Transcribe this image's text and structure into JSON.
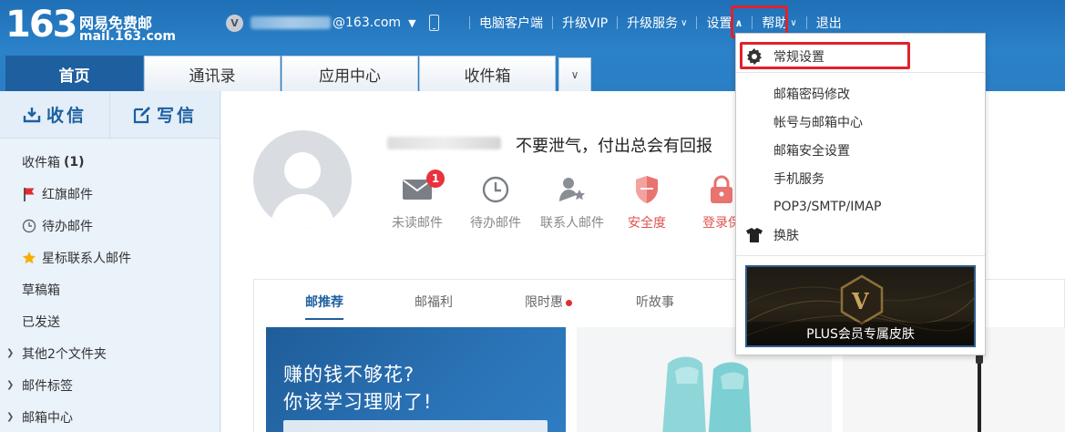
{
  "brand": {
    "logo_number": "163",
    "logo_cn": "网易免费邮",
    "logo_domain": "mail.163.com"
  },
  "account": {
    "badge_letter": "V",
    "email_suffix": "@163.com"
  },
  "topnav": {
    "desktop_client": "电脑客户端",
    "upgrade_vip": "升级VIP",
    "upgrade_service": "升级服务",
    "settings": "设置",
    "help": "帮助",
    "logout": "退出"
  },
  "tabs": [
    {
      "label": "首页"
    },
    {
      "label": "通讯录"
    },
    {
      "label": "应用中心"
    },
    {
      "label": "收件箱"
    }
  ],
  "sidebar": {
    "receive_label": "收信",
    "compose_label": "写信",
    "items": [
      {
        "label": "收件箱",
        "count": "(1)"
      },
      {
        "label": "红旗邮件"
      },
      {
        "label": "待办邮件"
      },
      {
        "label": "星标联系人邮件"
      },
      {
        "label": "草稿箱"
      },
      {
        "label": "已发送"
      },
      {
        "label": "其他2个文件夹"
      },
      {
        "label": "邮件标签"
      },
      {
        "label": "邮箱中心"
      }
    ]
  },
  "profile": {
    "motto": "不要泄气，付出总会有回报"
  },
  "quick_actions": [
    {
      "label": "未读邮件",
      "badge": "1"
    },
    {
      "label": "待办邮件"
    },
    {
      "label": "联系人邮件"
    },
    {
      "label": "安全度"
    },
    {
      "label": "登录保"
    }
  ],
  "recommend": {
    "tabs": [
      {
        "label": "邮推荐"
      },
      {
        "label": "邮福利"
      },
      {
        "label": "限时惠"
      },
      {
        "label": "听故事"
      }
    ],
    "banner_line1": "赚的钱不够花?",
    "banner_line2": "你该学习理财了!"
  },
  "settings_menu": {
    "items": [
      {
        "label": "常规设置"
      },
      {
        "label": "邮箱密码修改"
      },
      {
        "label": "帐号与邮箱中心"
      },
      {
        "label": "邮箱安全设置"
      },
      {
        "label": "手机服务"
      },
      {
        "label": "POP3/SMTP/IMAP"
      },
      {
        "label": "换肤"
      }
    ],
    "skin_badge": "V",
    "skin_caption": "PLUS会员专属皮肤"
  },
  "colors": {
    "header_blue": "#2a7ec4",
    "accent_blue": "#1d5f9f",
    "highlight_red": "#e0222a",
    "badge_red": "#e8323c"
  }
}
